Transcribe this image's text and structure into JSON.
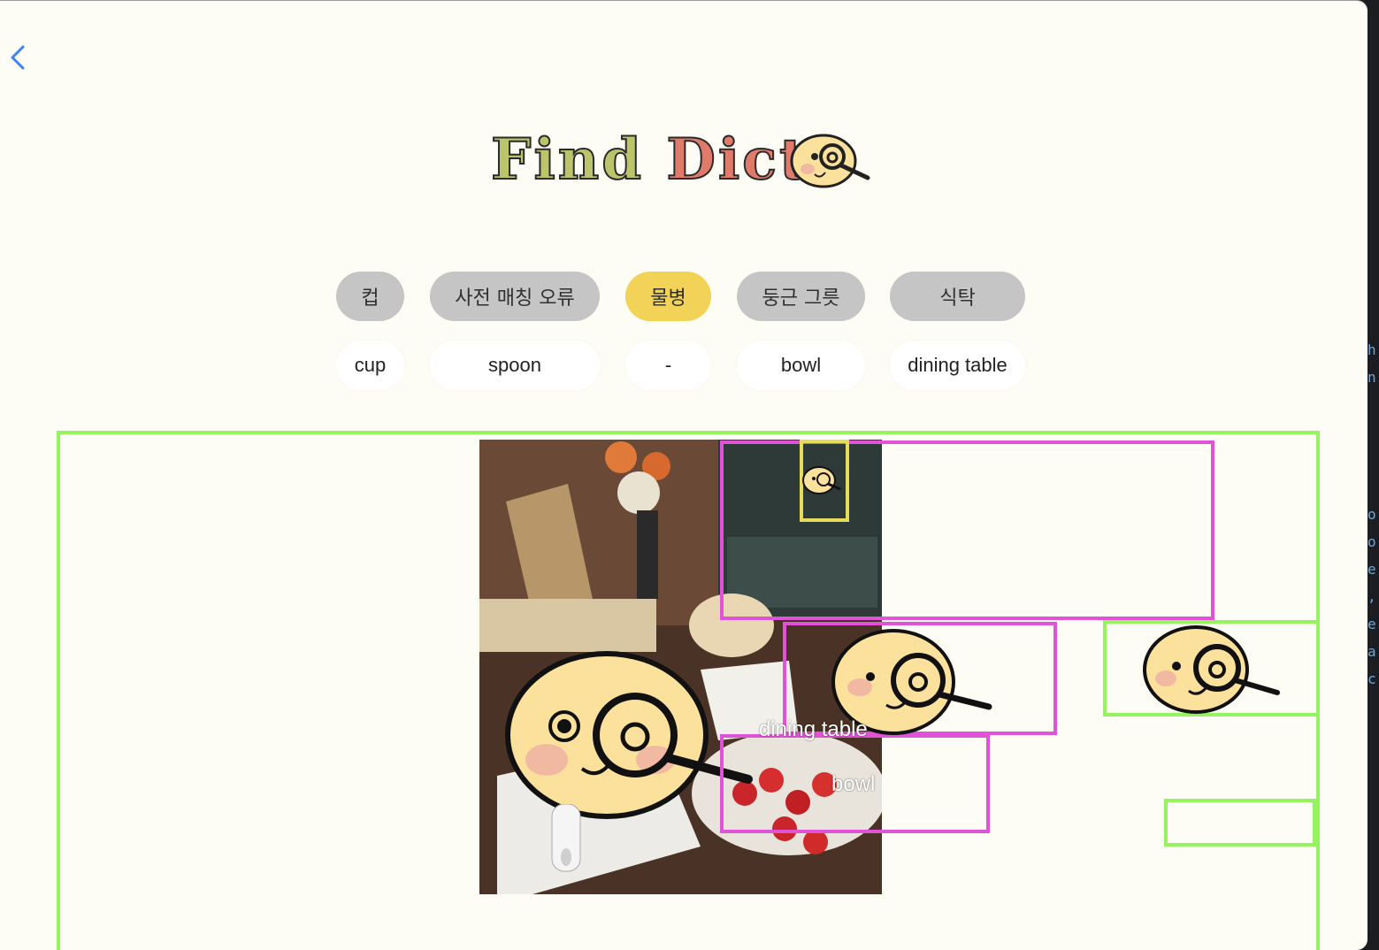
{
  "app": {
    "logo_text_1": "Find",
    "logo_text_2": "Dict"
  },
  "nav": {
    "back_icon": "chevron-left-icon"
  },
  "korean_chips": [
    {
      "label": "컵",
      "active": false
    },
    {
      "label": "사전 매칭 오류",
      "active": false
    },
    {
      "label": "물병",
      "active": true
    },
    {
      "label": "둥근 그릇",
      "active": false
    },
    {
      "label": "식탁",
      "active": false
    }
  ],
  "english_words": [
    "cup",
    "spoon",
    "-",
    "bowl",
    "dining table"
  ],
  "detections": {
    "labels": [
      "dining table",
      "bowl"
    ]
  },
  "colors": {
    "accent_yellow": "#f2d257",
    "chip_gray": "#c5c5c5",
    "box_pink": "#e052d6",
    "box_green": "#94f45e",
    "box_yellow": "#e4dc5a",
    "background": "#fefdf5"
  },
  "edge_glyphs": [
    "h",
    "n",
    "o",
    "o",
    "e",
    ",",
    "e",
    "a",
    "c"
  ]
}
